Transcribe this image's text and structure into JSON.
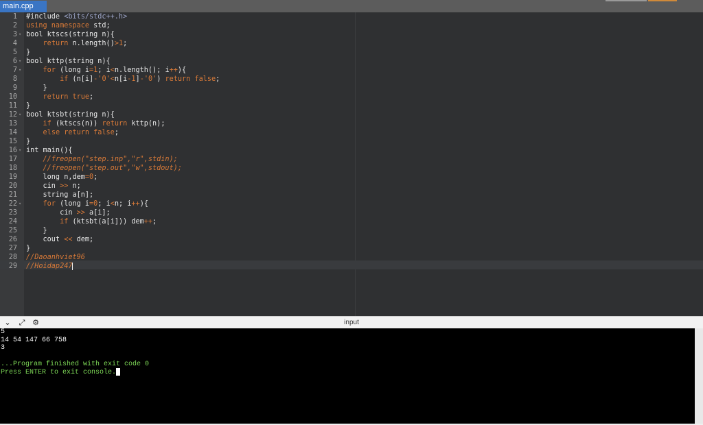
{
  "tab": {
    "label": "main.cpp"
  },
  "editor": {
    "lines": [
      {
        "n": "1",
        "fold": "",
        "tokens": [
          {
            "t": "#include ",
            "c": ""
          },
          {
            "t": "<bits/stdc++.h>",
            "c": "p"
          }
        ]
      },
      {
        "n": "2",
        "fold": "",
        "tokens": [
          {
            "t": "using namespace",
            "c": "k"
          },
          {
            "t": " std;",
            "c": ""
          }
        ]
      },
      {
        "n": "3",
        "fold": "▾",
        "tokens": [
          {
            "t": "bool ktscs(string n){",
            "c": ""
          }
        ]
      },
      {
        "n": "4",
        "fold": "",
        "tokens": [
          {
            "t": "    ",
            "c": ""
          },
          {
            "t": "return",
            "c": "k"
          },
          {
            "t": " n.length()",
            "c": ""
          },
          {
            "t": ">",
            "c": "k"
          },
          {
            "t": "1",
            "c": "n"
          },
          {
            "t": ";",
            "c": ""
          }
        ]
      },
      {
        "n": "5",
        "fold": "",
        "tokens": [
          {
            "t": "}",
            "c": ""
          }
        ]
      },
      {
        "n": "6",
        "fold": "▾",
        "tokens": [
          {
            "t": "bool kttp(string n){",
            "c": ""
          }
        ]
      },
      {
        "n": "7",
        "fold": "▾",
        "tokens": [
          {
            "t": "    ",
            "c": ""
          },
          {
            "t": "for",
            "c": "k"
          },
          {
            "t": " (long i",
            "c": ""
          },
          {
            "t": "=",
            "c": "k"
          },
          {
            "t": "1",
            "c": "n"
          },
          {
            "t": "; i",
            "c": ""
          },
          {
            "t": "<",
            "c": "k"
          },
          {
            "t": "n.length(); i",
            "c": ""
          },
          {
            "t": "++",
            "c": "k"
          },
          {
            "t": "){",
            "c": ""
          }
        ]
      },
      {
        "n": "8",
        "fold": "",
        "tokens": [
          {
            "t": "        ",
            "c": ""
          },
          {
            "t": "if",
            "c": "k"
          },
          {
            "t": " (n[i]",
            "c": ""
          },
          {
            "t": "-",
            "c": "k"
          },
          {
            "t": "'0'",
            "c": "s"
          },
          {
            "t": "<",
            "c": "k"
          },
          {
            "t": "n[i",
            "c": ""
          },
          {
            "t": "-",
            "c": "k"
          },
          {
            "t": "1",
            "c": "n"
          },
          {
            "t": "]",
            "c": ""
          },
          {
            "t": "-",
            "c": "k"
          },
          {
            "t": "'0'",
            "c": "s"
          },
          {
            "t": ") ",
            "c": ""
          },
          {
            "t": "return false",
            "c": "k"
          },
          {
            "t": ";",
            "c": ""
          }
        ]
      },
      {
        "n": "9",
        "fold": "",
        "tokens": [
          {
            "t": "    }",
            "c": ""
          }
        ]
      },
      {
        "n": "10",
        "fold": "",
        "tokens": [
          {
            "t": "    ",
            "c": ""
          },
          {
            "t": "return true",
            "c": "k"
          },
          {
            "t": ";",
            "c": ""
          }
        ]
      },
      {
        "n": "11",
        "fold": "",
        "tokens": [
          {
            "t": "}",
            "c": ""
          }
        ]
      },
      {
        "n": "12",
        "fold": "▾",
        "tokens": [
          {
            "t": "bool ktsbt(string n){",
            "c": ""
          }
        ]
      },
      {
        "n": "13",
        "fold": "",
        "tokens": [
          {
            "t": "    ",
            "c": ""
          },
          {
            "t": "if",
            "c": "k"
          },
          {
            "t": " (ktscs(n)) ",
            "c": ""
          },
          {
            "t": "return",
            "c": "k"
          },
          {
            "t": " kttp(n);",
            "c": ""
          }
        ]
      },
      {
        "n": "14",
        "fold": "",
        "tokens": [
          {
            "t": "    ",
            "c": ""
          },
          {
            "t": "else return false",
            "c": "k"
          },
          {
            "t": ";",
            "c": ""
          }
        ]
      },
      {
        "n": "15",
        "fold": "",
        "tokens": [
          {
            "t": "}",
            "c": ""
          }
        ]
      },
      {
        "n": "16",
        "fold": "▾",
        "tokens": [
          {
            "t": "int main(){",
            "c": ""
          }
        ]
      },
      {
        "n": "17",
        "fold": "",
        "tokens": [
          {
            "t": "    ",
            "c": ""
          },
          {
            "t": "//freopen(\"step.inp\",\"r\",stdin);",
            "c": "c"
          }
        ]
      },
      {
        "n": "18",
        "fold": "",
        "tokens": [
          {
            "t": "    ",
            "c": ""
          },
          {
            "t": "//freopen(\"step.out\",\"w\",stdout);",
            "c": "c"
          }
        ]
      },
      {
        "n": "19",
        "fold": "",
        "tokens": [
          {
            "t": "    long n,dem",
            "c": ""
          },
          {
            "t": "=",
            "c": "k"
          },
          {
            "t": "0",
            "c": "n"
          },
          {
            "t": ";",
            "c": ""
          }
        ]
      },
      {
        "n": "20",
        "fold": "",
        "tokens": [
          {
            "t": "    cin ",
            "c": ""
          },
          {
            "t": ">>",
            "c": "k"
          },
          {
            "t": " n;",
            "c": ""
          }
        ]
      },
      {
        "n": "21",
        "fold": "",
        "tokens": [
          {
            "t": "    string a[n];",
            "c": ""
          }
        ]
      },
      {
        "n": "22",
        "fold": "▾",
        "tokens": [
          {
            "t": "    ",
            "c": ""
          },
          {
            "t": "for",
            "c": "k"
          },
          {
            "t": " (long i",
            "c": ""
          },
          {
            "t": "=",
            "c": "k"
          },
          {
            "t": "0",
            "c": "n"
          },
          {
            "t": "; i",
            "c": ""
          },
          {
            "t": "<",
            "c": "k"
          },
          {
            "t": "n; i",
            "c": ""
          },
          {
            "t": "++",
            "c": "k"
          },
          {
            "t": "){",
            "c": ""
          }
        ]
      },
      {
        "n": "23",
        "fold": "",
        "tokens": [
          {
            "t": "        cin ",
            "c": ""
          },
          {
            "t": ">>",
            "c": "k"
          },
          {
            "t": " a[i];",
            "c": ""
          }
        ]
      },
      {
        "n": "24",
        "fold": "",
        "tokens": [
          {
            "t": "        ",
            "c": ""
          },
          {
            "t": "if",
            "c": "k"
          },
          {
            "t": " (ktsbt(a[i])) dem",
            "c": ""
          },
          {
            "t": "++",
            "c": "k"
          },
          {
            "t": ";",
            "c": ""
          }
        ]
      },
      {
        "n": "25",
        "fold": "",
        "tokens": [
          {
            "t": "    }",
            "c": ""
          }
        ]
      },
      {
        "n": "26",
        "fold": "",
        "tokens": [
          {
            "t": "    cout ",
            "c": ""
          },
          {
            "t": "<<",
            "c": "k"
          },
          {
            "t": " dem;",
            "c": ""
          }
        ]
      },
      {
        "n": "27",
        "fold": "",
        "tokens": [
          {
            "t": "}",
            "c": ""
          }
        ]
      },
      {
        "n": "28",
        "fold": "",
        "tokens": [
          {
            "t": "//Daoanhviet96",
            "c": "c"
          }
        ]
      },
      {
        "n": "29",
        "fold": "",
        "tokens": [
          {
            "t": "//Hoidap247",
            "c": "c"
          }
        ],
        "cursor": true
      }
    ]
  },
  "panel": {
    "title": "input",
    "icons": [
      "chevron-down-icon",
      "expand-icon",
      "settings-icon"
    ],
    "icon_glyphs": [
      "⌄",
      "⤢",
      "⚙"
    ]
  },
  "console": {
    "lines": [
      {
        "text": "5",
        "green": false
      },
      {
        "text": "14 54 147 66 758",
        "green": false
      },
      {
        "text": "3",
        "green": false
      },
      {
        "text": "",
        "green": false
      },
      {
        "text": "...Program finished with exit code 0",
        "green": true
      },
      {
        "text": "Press ENTER to exit console.",
        "green": true,
        "cursor": true
      }
    ]
  }
}
